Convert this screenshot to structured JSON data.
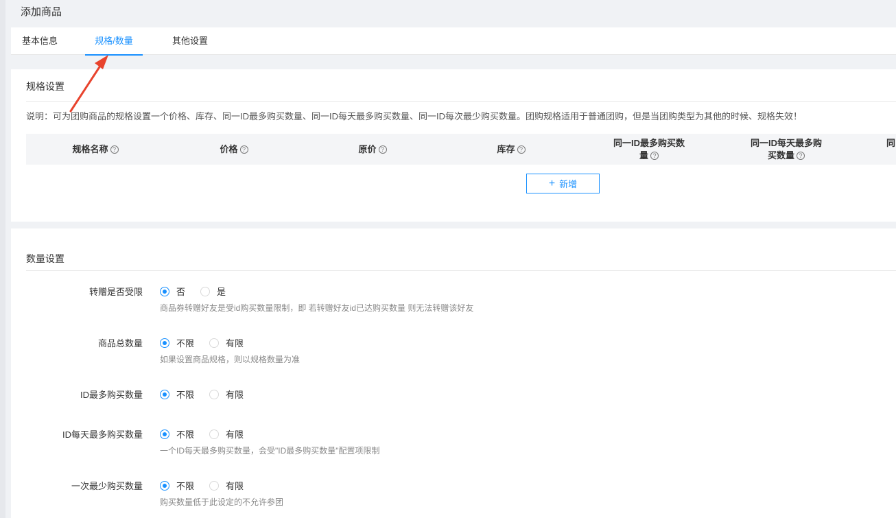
{
  "page": {
    "title": "添加商品"
  },
  "tabs": [
    {
      "label": "基本信息",
      "active": false
    },
    {
      "label": "规格/数量",
      "active": true
    },
    {
      "label": "其他设置",
      "active": false
    }
  ],
  "spec_section": {
    "title": "规格设置",
    "note": "说明：可为团购商品的规格设置一个价格、库存、同一ID最多购买数量、同一ID每天最多购买数量、同一ID每次最少购买数量。团购规格适用于普通团购，但是当团购类型为其他的时候、规格失效！",
    "columns": [
      {
        "line1": "规格名称",
        "line2": ""
      },
      {
        "line1": "价格",
        "line2": ""
      },
      {
        "line1": "原价",
        "line2": ""
      },
      {
        "line1": "库存",
        "line2": ""
      },
      {
        "line1": "同一ID最多购买数",
        "line2": "量"
      },
      {
        "line1": "同一ID每天最多购",
        "line2": "买数量"
      },
      {
        "line1": "同",
        "line2": ""
      }
    ],
    "add_button": "新增",
    "help_glyph": "?"
  },
  "qty_section": {
    "title": "数量设置",
    "rows": [
      {
        "label": "转赠是否受限",
        "options": [
          "否",
          "是"
        ],
        "selected": 0,
        "hint": "商品券转赠好友是受id购买数量限制，即 若转赠好友id已达购买数量 则无法转赠该好友"
      },
      {
        "label": "商品总数量",
        "options": [
          "不限",
          "有限"
        ],
        "selected": 0,
        "hint": "如果设置商品规格，则以规格数量为准"
      },
      {
        "label": "ID最多购买数量",
        "options": [
          "不限",
          "有限"
        ],
        "selected": 0,
        "hint": ""
      },
      {
        "label": "ID每天最多购买数量",
        "options": [
          "不限",
          "有限"
        ],
        "selected": 0,
        "hint": "一个ID每天最多购买数量，会受\"ID最多购买数量\"配置项限制"
      },
      {
        "label": "一次最少购买数量",
        "options": [
          "不限",
          "有限"
        ],
        "selected": 0,
        "hint": "购买数量低于此设定的不允许参团"
      }
    ]
  },
  "colors": {
    "accent": "#1890ff",
    "annotation_arrow": "#e8432d"
  }
}
